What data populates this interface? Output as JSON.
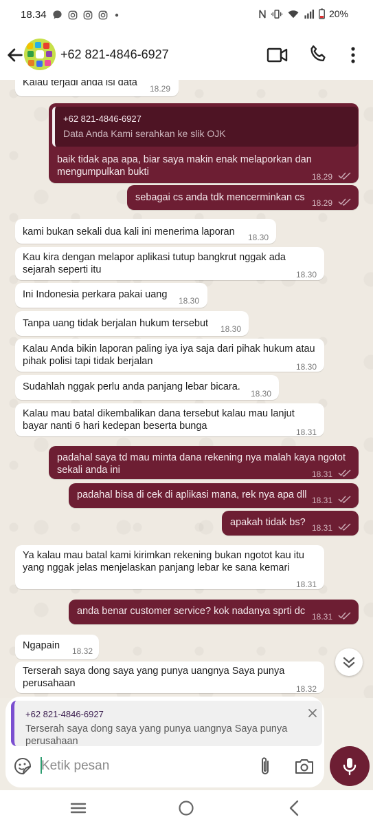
{
  "status_bar": {
    "time": "18.34",
    "battery": "20%",
    "icons": [
      "chat-bubble-icon",
      "instagram-icon",
      "instagram-icon",
      "instagram-icon",
      "dot-icon",
      "nfc-icon",
      "vibrate-icon",
      "wifi-icon",
      "signal-icon",
      "battery-icon"
    ]
  },
  "header": {
    "contact_name": "+62 821-4846-6927",
    "icons": [
      "back-arrow-icon",
      "video-call-icon",
      "phone-icon",
      "more-vert-icon"
    ]
  },
  "colors": {
    "outgoing_bubble": "#6d1e33",
    "incoming_bubble": "#ffffff",
    "accent": "#6d1e33",
    "reply_accent": "#7b4fd0"
  },
  "messages": [
    {
      "dir": "in",
      "lines": [
        "Kalau terjadi anda isi data"
      ],
      "time": "18.29"
    },
    {
      "dir": "out",
      "quote": {
        "name": "+62 821-4846-6927",
        "text": "Data Anda Kami serahkan ke slik OJK"
      },
      "lines": [
        "baik tidak apa apa, biar saya makin enak melaporkan dan",
        "mengumpulkan bukti"
      ],
      "time": "18.29"
    },
    {
      "dir": "out",
      "lines": [
        "sebagai cs anda tdk mencerminkan cs"
      ],
      "time": "18.29"
    },
    {
      "dir": "in",
      "lines": [
        "kami bukan sekali dua kali ini menerima laporan"
      ],
      "time": "18.30"
    },
    {
      "dir": "in",
      "lines": [
        "Kau kira dengan melapor aplikasi tutup bangkrut nggak ada",
        "sejarah seperti itu"
      ],
      "time": "18.30"
    },
    {
      "dir": "in",
      "lines": [
        "Ini Indonesia perkara pakai uang"
      ],
      "time": "18.30"
    },
    {
      "dir": "in",
      "lines": [
        "Tanpa uang tidak berjalan hukum tersebut"
      ],
      "time": "18.30"
    },
    {
      "dir": "in",
      "lines": [
        "Kalau Anda bikin laporan paling iya iya saja dari pihak hukum atau",
        "pihak polisi tapi tidak berjalan"
      ],
      "time": "18.30"
    },
    {
      "dir": "in",
      "lines": [
        "Sudahlah nggak perlu anda panjang lebar bicara."
      ],
      "time": "18.30"
    },
    {
      "dir": "in",
      "lines": [
        "Kalau mau batal dikembalikan dana tersebut kalau mau lanjut",
        "bayar nanti 6 hari kedepan beserta bunga"
      ],
      "time": "18.31"
    },
    {
      "dir": "out",
      "lines": [
        "padahal saya td mau minta dana rekening nya malah kaya ngotot",
        "sekali anda ini"
      ],
      "time": "18.31"
    },
    {
      "dir": "out",
      "lines": [
        "padahal bisa di cek di aplikasi mana, rek nya apa dll"
      ],
      "time": "18.31"
    },
    {
      "dir": "out",
      "lines": [
        "apakah tidak bs?"
      ],
      "time": "18.31"
    },
    {
      "dir": "in",
      "lines": [
        "Ya kalau mau batal kami kirimkan rekening bukan ngotot kau itu",
        "yang nggak jelas menjelaskan panjang lebar ke sana kemari"
      ],
      "time": "18.31"
    },
    {
      "dir": "out",
      "lines": [
        "anda benar customer service? kok nadanya sprti dc"
      ],
      "time": "18.31"
    },
    {
      "dir": "in",
      "lines": [
        "Ngapain"
      ],
      "time": "18.32"
    },
    {
      "dir": "in",
      "lines": [
        "Terserah saya dong saya yang punya uangnya Saya punya",
        "perusahaan"
      ],
      "time": "18.32"
    }
  ],
  "composer": {
    "reply_to_name": "+62 821-4846-6927",
    "reply_to_text": "Terserah saya dong saya yang punya uangnya Saya punya perusahaan",
    "placeholder": "Ketik pesan",
    "value": ""
  }
}
